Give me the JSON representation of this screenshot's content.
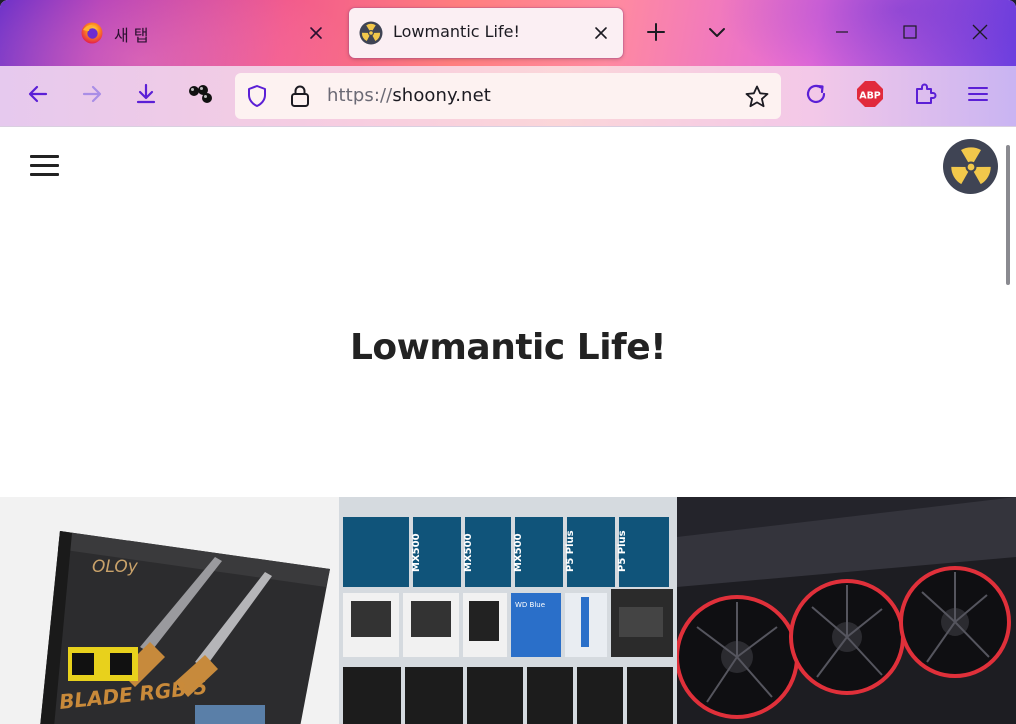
{
  "browser": {
    "tabs": [
      {
        "label": "새 탭",
        "icon": "firefox-icon",
        "active": false
      },
      {
        "label": "Lowmantic Life!",
        "icon": "radiation-icon",
        "active": true
      }
    ],
    "new_tab_icon": "plus-icon",
    "tab_list_icon": "chevron-down-icon",
    "window_controls": [
      "minimize-icon",
      "maximize-icon",
      "close-icon"
    ]
  },
  "toolbar": {
    "buttons": [
      "back-arrow-icon",
      "forward-arrow-icon",
      "download-icon",
      "extension-balls-icon"
    ],
    "url_scheme": "https://",
    "url_host": "shoony.net",
    "right_buttons": [
      "bookmark-star-icon",
      "reload-icon",
      "adblock-plus-icon",
      "extensions-puzzle-icon",
      "app-menu-icon"
    ],
    "abp_label": "ABP"
  },
  "page": {
    "title": "Lowmantic Life!",
    "menu_icon": "hamburger-menu-icon",
    "avatar_icon": "radiation-icon",
    "thumbnails": [
      {
        "subject": "OLOy BLADE RGB 5 DDR5 memory box",
        "brand_text": "OLOy",
        "product_text": "BLADE RGB 5"
      },
      {
        "subject": "SSD product boxes collection",
        "labels": [
          "MX500",
          "MX500",
          "MX500",
          "P5 Plus",
          "P5 Plus",
          "WD Blue"
        ]
      },
      {
        "subject": "Graphics card with triple fans"
      }
    ]
  },
  "colors": {
    "accent_purple": "#5b1fd6",
    "abp_red": "#e12a3c",
    "avatar_bg": "#3f4454",
    "radiation_yellow": "#f2c84b"
  }
}
